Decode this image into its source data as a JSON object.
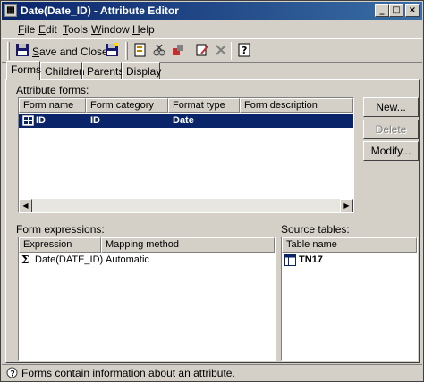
{
  "window": {
    "title": "Date(Date_ID) - Attribute Editor",
    "minimize_glyph": "_",
    "maximize_glyph": "□",
    "close_glyph": "×"
  },
  "menu": [
    {
      "label": "File",
      "mnemonic": "F",
      "rest": "ile"
    },
    {
      "label": "Edit",
      "mnemonic": "E",
      "rest": "dit"
    },
    {
      "label": "Tools",
      "mnemonic": "T",
      "rest": "ools"
    },
    {
      "label": "Window",
      "mnemonic": "W",
      "rest": "indow"
    },
    {
      "label": "Help",
      "mnemonic": "H",
      "rest": "elp"
    }
  ],
  "toolbar": {
    "save_close_mnemonic": "S",
    "save_close_rest": "ave and Close"
  },
  "tabs": [
    "Forms",
    "Children",
    "Parents",
    "Display"
  ],
  "attribute_forms": {
    "label": "Attribute forms:",
    "columns": [
      "Form name",
      "Form category",
      "Format type",
      "Form description"
    ],
    "rows": [
      {
        "name": "ID",
        "category": "ID",
        "format": "Date",
        "description": ""
      }
    ]
  },
  "buttons": {
    "new": "New...",
    "delete": "Delete",
    "modify": "Modify..."
  },
  "form_expressions": {
    "label": "Form expressions:",
    "columns": [
      "Expression",
      "Mapping method"
    ],
    "rows": [
      {
        "expression": "Date(DATE_ID)",
        "mapping": "Automatic"
      }
    ]
  },
  "source_tables": {
    "label": "Source tables:",
    "columns": [
      "Table name"
    ],
    "rows": [
      {
        "name": "TN17"
      }
    ]
  },
  "status": {
    "text": "Forms contain information about an attribute."
  }
}
